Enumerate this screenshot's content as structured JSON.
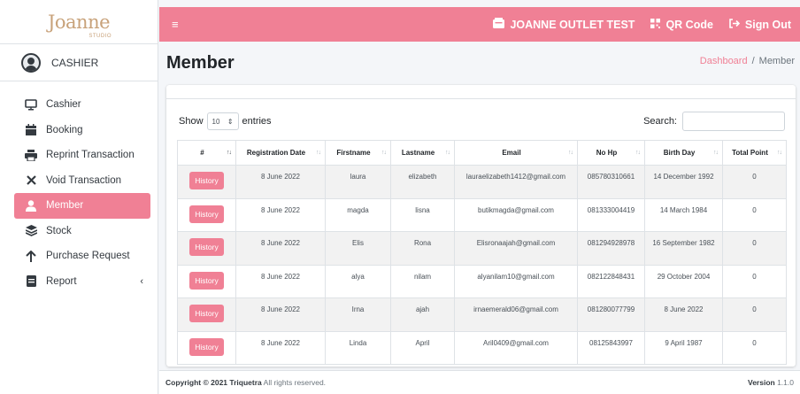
{
  "brand": {
    "logo": "Joanne",
    "sub": "STUDIO"
  },
  "user": {
    "name": "CASHIER"
  },
  "nav": [
    {
      "label": "Cashier",
      "icon": "monitor-icon"
    },
    {
      "label": "Booking",
      "icon": "calendar-icon"
    },
    {
      "label": "Reprint Transaction",
      "icon": "print-icon"
    },
    {
      "label": "Void Transaction",
      "icon": "x-icon"
    },
    {
      "label": "Member",
      "icon": "user-icon",
      "active": true
    },
    {
      "label": "Stock",
      "icon": "layers-icon"
    },
    {
      "label": "Purchase Request",
      "icon": "arrow-up-icon"
    },
    {
      "label": "Report",
      "icon": "report-icon",
      "chevron": "‹"
    }
  ],
  "topbar": {
    "menu_icon": "≡",
    "store": "JOANNE OUTLET TEST",
    "qr": "QR Code",
    "signout": "Sign Out"
  },
  "page": {
    "title": "Member",
    "breadcrumb_home": "Dashboard",
    "breadcrumb_sep": "/",
    "breadcrumb_current": "Member"
  },
  "table_controls": {
    "show_label": "Show",
    "length_value": "10",
    "entries_label": "entries",
    "search_label": "Search:"
  },
  "columns": [
    "#",
    "Registration Date",
    "Firstname",
    "Lastname",
    "Email",
    "No Hp",
    "Birth Day",
    "Total Point"
  ],
  "rows": [
    {
      "action": "History",
      "reg": "8 June 2022",
      "first": "laura",
      "last": "elizabeth",
      "email": "lauraelizabeth1412@gmail.com",
      "hp": "085780310661",
      "birth": "14 December 1992",
      "points": "0"
    },
    {
      "action": "History",
      "reg": "8 June 2022",
      "first": "magda",
      "last": "lisna",
      "email": "butikmagda@gmail.com",
      "hp": "081333004419",
      "birth": "14 March 1984",
      "points": "0"
    },
    {
      "action": "History",
      "reg": "8 June 2022",
      "first": "Elis",
      "last": "Rona",
      "email": "Elisronaajah@gmail.com",
      "hp": "081294928978",
      "birth": "16 September 1982",
      "points": "0"
    },
    {
      "action": "History",
      "reg": "8 June 2022",
      "first": "alya",
      "last": "nilam",
      "email": "alyanilam10@gmail.com",
      "hp": "082122848431",
      "birth": "29 October 2004",
      "points": "0"
    },
    {
      "action": "History",
      "reg": "8 June 2022",
      "first": "Irna",
      "last": "ajah",
      "email": "irnaemerald06@gmail.com",
      "hp": "081280077799",
      "birth": "8 June 2022",
      "points": "0"
    },
    {
      "action": "History",
      "reg": "8 June 2022",
      "first": "Linda",
      "last": "April",
      "email": "Aril0409@gmail.com",
      "hp": "08125843997",
      "birth": "9 April 1987",
      "points": "0"
    }
  ],
  "footer": {
    "copyright": "Copyright © 2021 Triquetra",
    "rights": " All rights reserved.",
    "version_label": "Version",
    "version": " 1.1.0"
  },
  "colors": {
    "accent": "#f08095",
    "brand_gold": "#c8a27a"
  }
}
